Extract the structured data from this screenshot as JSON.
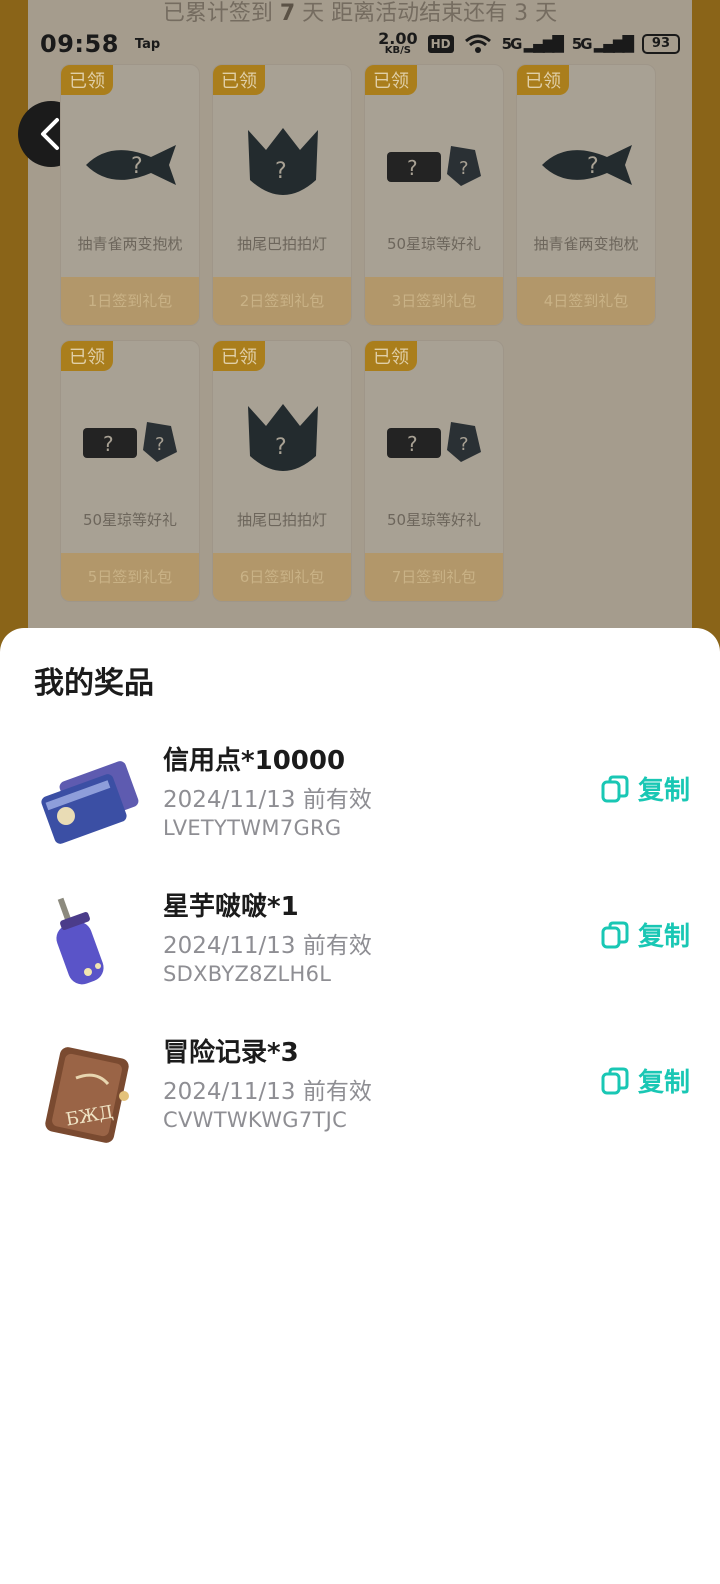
{
  "status_bar": {
    "time": "09:58",
    "app_badge": "Tap",
    "net_speed": "2.00",
    "net_unit": "KB/S",
    "hd": "HD",
    "signal1": "5G",
    "signal2": "5G",
    "battery": "93"
  },
  "background": {
    "header_prefix": "已累计签到",
    "header_days": "7",
    "header_suffix": "天  距离活动结束还有 3 天",
    "cards": [
      {
        "tag": "已领",
        "name": "抽青雀两变抱枕",
        "footer": "1日签到礼包",
        "icon": "fish-icon"
      },
      {
        "tag": "已领",
        "name": "抽尾巴拍拍灯",
        "footer": "2日签到礼包",
        "icon": "fox-icon"
      },
      {
        "tag": "已领",
        "name": "50星琼等好礼",
        "footer": "3日签到礼包",
        "icon": "gem-icon"
      },
      {
        "tag": "已领",
        "name": "抽青雀两变抱枕",
        "footer": "4日签到礼包",
        "icon": "fish-icon"
      },
      {
        "tag": "已领",
        "name": "50星琼等好礼",
        "footer": "5日签到礼包",
        "icon": "gem-icon"
      },
      {
        "tag": "已领",
        "name": "抽尾巴拍拍灯",
        "footer": "6日签到礼包",
        "icon": "fox-icon"
      },
      {
        "tag": "已领",
        "name": "50星琼等好礼",
        "footer": "7日签到礼包",
        "icon": "gem-icon"
      }
    ]
  },
  "sheet": {
    "title": "我的奖品",
    "copy_label": "复制",
    "prizes": [
      {
        "name": "信用点*10000",
        "expiry": "2024/11/13 前有效",
        "code": "LVETYTWM7GRG",
        "icon": "credit-card-icon"
      },
      {
        "name": "星芋啵啵*1",
        "expiry": "2024/11/13 前有效",
        "code": "SDXBYZ8ZLH6L",
        "icon": "bottle-icon"
      },
      {
        "name": "冒险记录*3",
        "expiry": "2024/11/13 前有效",
        "code": "CVWTWKWG7TJC",
        "icon": "book-icon"
      }
    ]
  },
  "colors": {
    "accent": "#19c7b4",
    "tag_gold": "#aa7e1c"
  }
}
